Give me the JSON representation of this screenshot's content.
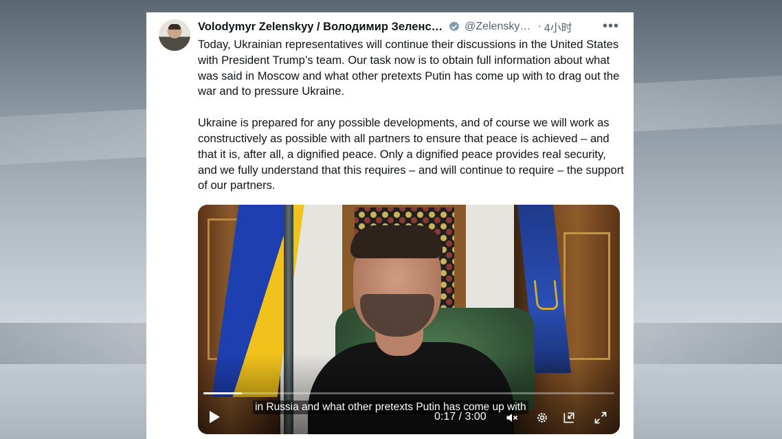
{
  "tweet": {
    "author_name": "Volodymyr Zelenskyy / Володимир Зеленс…",
    "handle": "@Zelensky…",
    "separator": "·",
    "time": "4小时",
    "more_label": "•••",
    "icons": {
      "verified": "verified-badge-icon",
      "more": "more-options-icon"
    },
    "paragraphs": [
      "Today, Ukrainian representatives will continue their discussions in the United States with President Trump’s team. Our task now is to obtain full information about what was said in Moscow and what other pretexts Putin has come up with to drag out the war and to pressure Ukraine.",
      "Ukraine is prepared for any possible developments, and of course we will work as constructively as possible with all partners to ensure that peace is achieved – and that it is, after all, a dignified peace. Only a dignified peace provides real security, and we fully understand that this requires – and will continue to require – the support of our partners."
    ]
  },
  "video": {
    "subtitle": "in Russia and what other pretexts Putin has come up with",
    "time_current": "0:17",
    "time_sep": "/",
    "time_total": "3:00",
    "progress": 0.094,
    "icons": [
      "play-icon",
      "mute-icon",
      "settings-icon",
      "pip-icon",
      "fullscreen-icon"
    ]
  },
  "colors": {
    "text": "#0f1419",
    "secondary": "#536471",
    "verified": "#829aab"
  }
}
